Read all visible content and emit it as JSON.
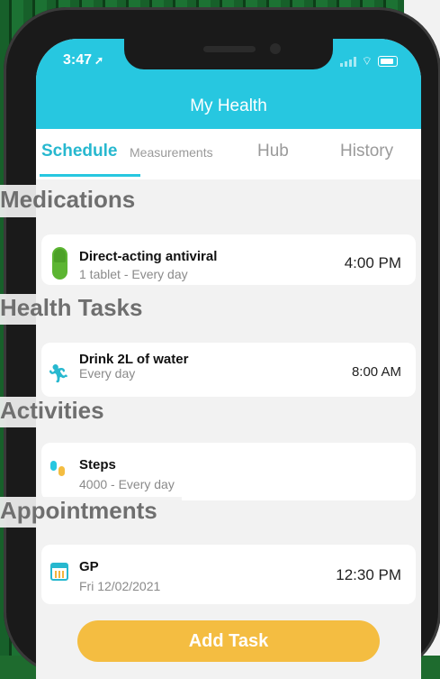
{
  "status_bar": {
    "time": "3:47",
    "location_arrow": "location-arrow-icon"
  },
  "header": {
    "title": "My Health"
  },
  "tabs": [
    {
      "label": "Schedule",
      "active": true
    },
    {
      "label": "Measurements"
    },
    {
      "label": "Hub"
    },
    {
      "label": "History"
    }
  ],
  "sections": {
    "medications": {
      "title": "Medications",
      "item": {
        "title": "Direct-acting antiviral",
        "subtitle": "1 tablet - Every day",
        "time": "4:00 PM",
        "icon": "pill-icon"
      }
    },
    "health_tasks": {
      "title": "Health Tasks",
      "item": {
        "title": "Drink 2L of water",
        "subtitle": "Every day",
        "time": "8:00 AM",
        "icon": "runner-icon"
      }
    },
    "activities": {
      "title": "Activities",
      "item": {
        "title": "Steps",
        "subtitle": "4000 - Every day",
        "icon": "footprints-icon"
      }
    },
    "appointments": {
      "title": "Appointments",
      "item": {
        "title": "GP",
        "subtitle": "Fri 12/02/2021",
        "time": "12:30 PM",
        "icon": "calendar-icon"
      }
    }
  },
  "add_button": {
    "label": "Add Task"
  },
  "colors": {
    "accent": "#27c7e0",
    "button": "#f4bd41",
    "pill": "#5cb532"
  }
}
